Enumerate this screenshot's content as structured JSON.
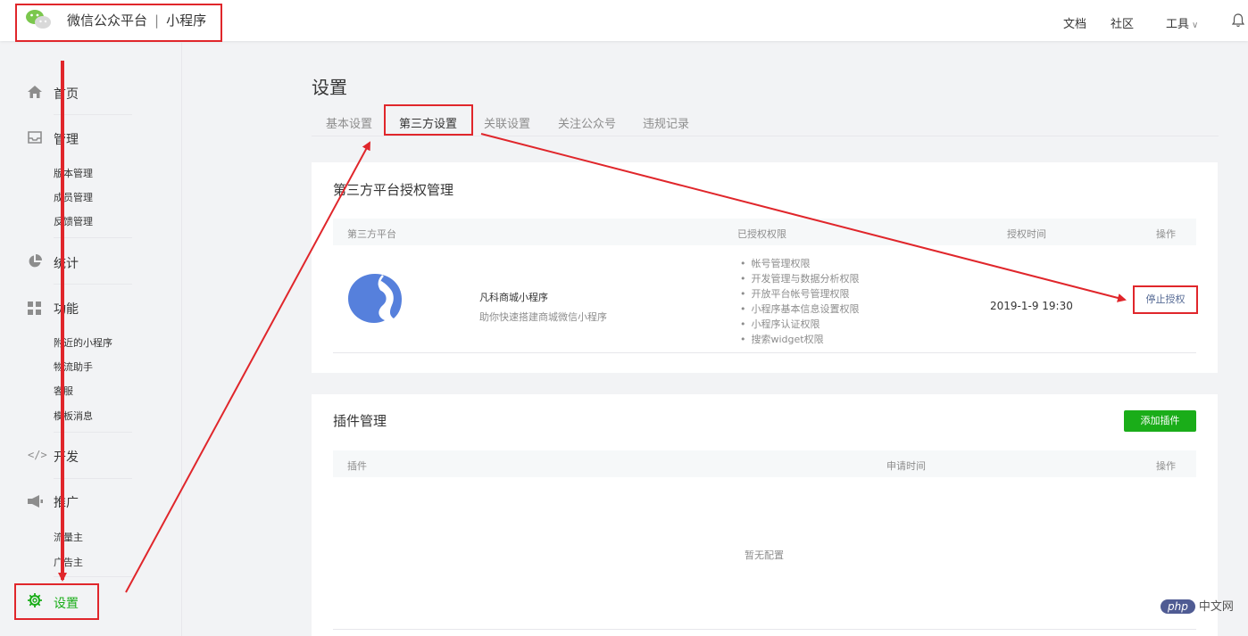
{
  "header": {
    "brand": "微信公众平台",
    "separator": "|",
    "product": "小程序",
    "nav": [
      "文档",
      "社区",
      "工具"
    ],
    "logo_icon": "wechat-logo-icon",
    "bell_icon": "bell-icon"
  },
  "sidebar": {
    "home": "首页",
    "manage": "管理",
    "manage_items": [
      "版本管理",
      "成员管理",
      "反馈管理"
    ],
    "stats": "统计",
    "features": "功能",
    "feature_items": [
      "附近的小程序",
      "物流助手",
      "客服",
      "模板消息"
    ],
    "develop": "开发",
    "promote": "推广",
    "promote_items": [
      "流量主",
      "广告主"
    ],
    "settings": "设置"
  },
  "page": {
    "title": "设置",
    "tabs": [
      "基本设置",
      "第三方设置",
      "关联设置",
      "关注公众号",
      "违规记录"
    ],
    "active_tab": 1
  },
  "third_party": {
    "title": "第三方平台授权管理",
    "columns": [
      "第三方平台",
      "已授权权限",
      "授权时间",
      "操作"
    ],
    "row": {
      "name": "凡科商城小程序",
      "desc": "助你快速搭建商城微信小程序",
      "permissions": [
        "帐号管理权限",
        "开发管理与数据分析权限",
        "开放平台帐号管理权限",
        "小程序基本信息设置权限",
        "小程序认证权限",
        "搜索widget权限"
      ],
      "time": "2019-1-9 19:30",
      "action": "停止授权"
    }
  },
  "plugins": {
    "title": "插件管理",
    "add_button": "添加插件",
    "columns": [
      "插件",
      "申请时间",
      "操作"
    ],
    "empty": "暂无配置"
  },
  "watermark": {
    "badge": "php",
    "text": "中文网"
  },
  "colors": {
    "accent_green": "#1aad19",
    "annotation_red": "#e0262b",
    "link_blue": "#576b95"
  }
}
